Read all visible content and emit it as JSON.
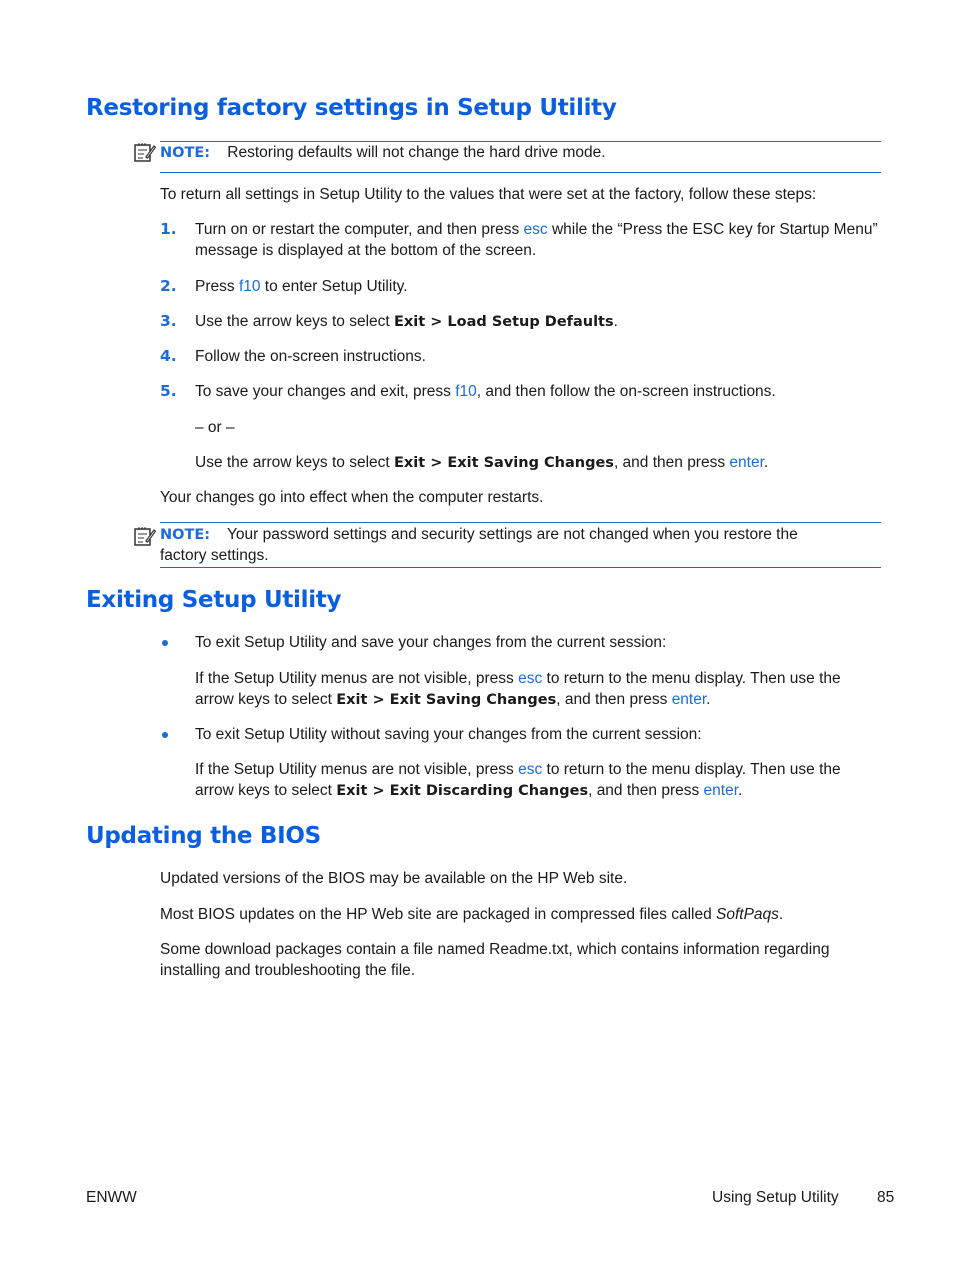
{
  "sections": {
    "restoring": {
      "heading": "Restoring factory settings in Setup Utility",
      "note1": {
        "label": "NOTE:",
        "text": "Restoring defaults will not change the hard drive mode."
      },
      "intro": "To return all settings in Setup Utility to the values that were set at the factory, follow these steps:",
      "steps": [
        {
          "num": "1.",
          "pre": "Turn on or restart the computer, and then press ",
          "key": "esc",
          "post": " while the “Press the ESC key for Startup Menu”",
          "line2": "message is displayed at the bottom of the screen."
        },
        {
          "num": "2.",
          "pre": "Press ",
          "key": "f10",
          "post": " to enter Setup Utility."
        },
        {
          "num": "3.",
          "pre": "Use the arrow keys to select ",
          "bold": "Exit > Load Setup Defaults",
          "post": "."
        },
        {
          "num": "4.",
          "text": "Follow the on-screen instructions."
        },
        {
          "num": "5.",
          "pre": "To save your changes and exit, press ",
          "key": "f10",
          "post": ", and then follow the on-screen instructions."
        }
      ],
      "or": "– or –",
      "alt": {
        "pre": "Use the arrow keys to select ",
        "bold": "Exit > Exit Saving Changes",
        "mid": ", and then press ",
        "key": "enter",
        "post": "."
      },
      "restart": "Your changes go into effect when the computer restarts.",
      "note2": {
        "label": "NOTE:",
        "line1": "Your password settings and security settings are not changed when you restore the",
        "line2": "factory settings."
      }
    },
    "exiting": {
      "heading": "Exiting Setup Utility",
      "items": [
        {
          "bullet": "To exit Setup Utility and save your changes from the current session:",
          "l1pre": "If the Setup Utility menus are not visible, press ",
          "l1key": "esc",
          "l1post": " to return to the menu display. Then use the",
          "l2pre": "arrow keys to select ",
          "l2bold": "Exit > Exit Saving Changes",
          "l2mid": ", and then press ",
          "l2key": "enter",
          "l2post": "."
        },
        {
          "bullet": "To exit Setup Utility without saving your changes from the current session:",
          "l1pre": "If the Setup Utility menus are not visible, press ",
          "l1key": "esc",
          "l1post": " to return to the menu display. Then use the",
          "l2pre": "arrow keys to select ",
          "l2bold": "Exit > Exit Discarding Changes",
          "l2mid": ", and then press ",
          "l2key": "enter",
          "l2post": "."
        }
      ]
    },
    "bios": {
      "heading": "Updating the BIOS",
      "p1": "Updated versions of the BIOS may be available on the HP Web site.",
      "p2pre": "Most BIOS updates on the HP Web site are packaged in compressed files called ",
      "p2em": "SoftPaqs",
      "p2post": ".",
      "p3l1": "Some download packages contain a file named Readme.txt, which contains information regarding",
      "p3l2": "installing and troubleshooting the file."
    }
  },
  "footer": {
    "left": "ENWW",
    "section": "Using Setup Utility",
    "page": "85"
  },
  "colors": {
    "accent": "#0a5fe0",
    "key": "#1a6bdc"
  }
}
